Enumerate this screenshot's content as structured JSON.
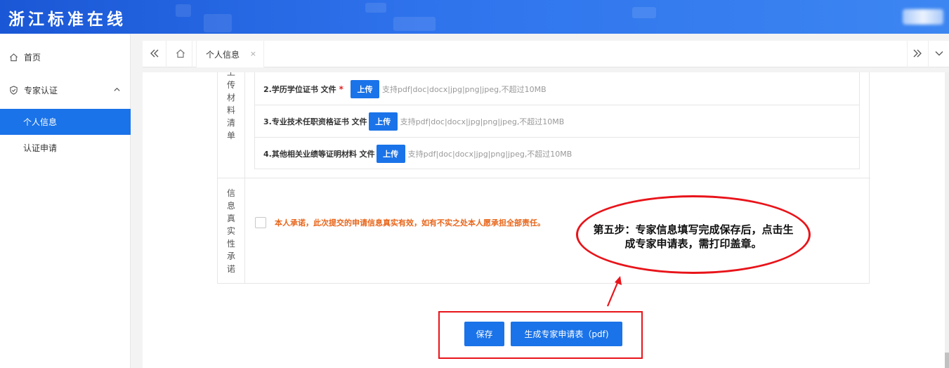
{
  "app": {
    "title": "浙江标准在线"
  },
  "colors": {
    "primary": "#1a73e8",
    "header": "#2f73ec",
    "warning_text": "#e8651a",
    "annotation_red": "#e8141a",
    "required": "#e02020"
  },
  "sidebar": {
    "home": {
      "label": "首页",
      "icon": "home-icon"
    },
    "group": {
      "label": "专家认证",
      "icon": "shield-check-icon",
      "expanded": true
    },
    "items": [
      {
        "label": "个人信息",
        "active": true
      },
      {
        "label": "认证申请",
        "active": false
      }
    ]
  },
  "tabbar": {
    "tabs": [
      {
        "label": "个人信息",
        "close": "×"
      }
    ]
  },
  "form": {
    "upload_label": "上传材料清单",
    "upload_label_chars": [
      "上",
      "传",
      "材",
      "料",
      "清",
      "单"
    ],
    "uploads": [
      {
        "name": "2.学历学位证书 文件",
        "required_mark": "*",
        "button": "上传",
        "hint": "支持pdf|doc|docx|jpg|png|jpeg,不超过10MB"
      },
      {
        "name": "3.专业技术任职资格证书 文件",
        "required_mark": "",
        "button": "上传",
        "hint": "支持pdf|doc|docx|jpg|png|jpeg,不超过10MB"
      },
      {
        "name": "4.其他相关业绩等证明材料 文件",
        "required_mark": "",
        "button": "上传",
        "hint": "支持pdf|doc|docx|jpg|png|jpeg,不超过10MB"
      }
    ],
    "promise_label_chars": [
      "信",
      "息",
      "真",
      "实",
      "性",
      "承",
      "诺"
    ],
    "promise_text": "本人承诺，此次提交的申请信息真实有效，如有不实之处本人愿承担全部责任。",
    "promise_checked": false
  },
  "annotation": {
    "line1": "第五步：专家信息填写完成保存后，点击生",
    "line2": "成专家申请表，需打印盖章。"
  },
  "actions": {
    "save": "保存",
    "generate": "生成专家申请表（pdf)"
  }
}
